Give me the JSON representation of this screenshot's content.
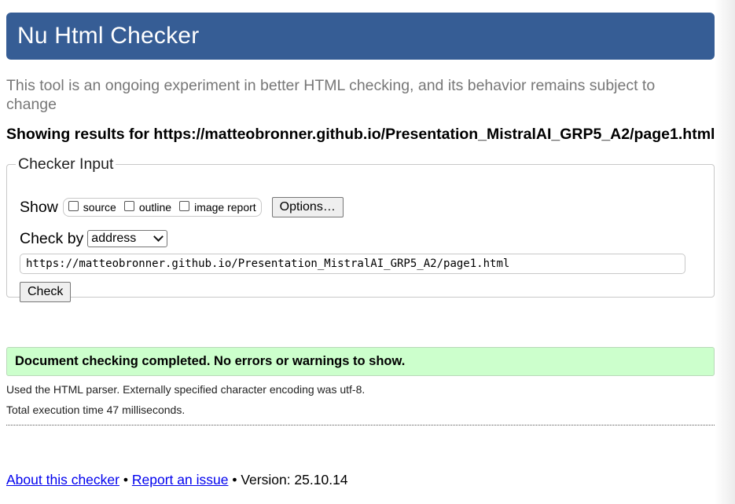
{
  "header": {
    "title": "Nu Html Checker"
  },
  "intro": {
    "text": "This tool is an ongoing experiment in better HTML checking, and its behavior remains subject to change"
  },
  "results": {
    "heading": "Showing results for https://matteobronner.github.io/Presentation_MistralAI_GRP5_A2/page1.html"
  },
  "checker_input": {
    "legend": "Checker Input",
    "show_label": "Show",
    "show_options": [
      {
        "label": "source",
        "checked": false
      },
      {
        "label": "outline",
        "checked": false
      },
      {
        "label": "image report",
        "checked": false
      }
    ],
    "options_button": "Options…",
    "check_by_label": "Check by",
    "check_by_value": "address",
    "url_value": "https://matteobronner.github.io/Presentation_MistralAI_GRP5_A2/page1.html",
    "check_button": "Check"
  },
  "result": {
    "success_message": "Document checking completed. No errors or warnings to show.",
    "parser_info": "Used the HTML parser. Externally specified character encoding was utf-8.",
    "timing": "Total execution time 47 milliseconds."
  },
  "footer": {
    "about_link": "About this checker",
    "separator": "•",
    "report_link": "Report an issue",
    "version": "Version: 25.10.14"
  },
  "colors": {
    "header_bg": "#365d95",
    "success_bg": "#ccffcc",
    "link": "#0000ee"
  }
}
